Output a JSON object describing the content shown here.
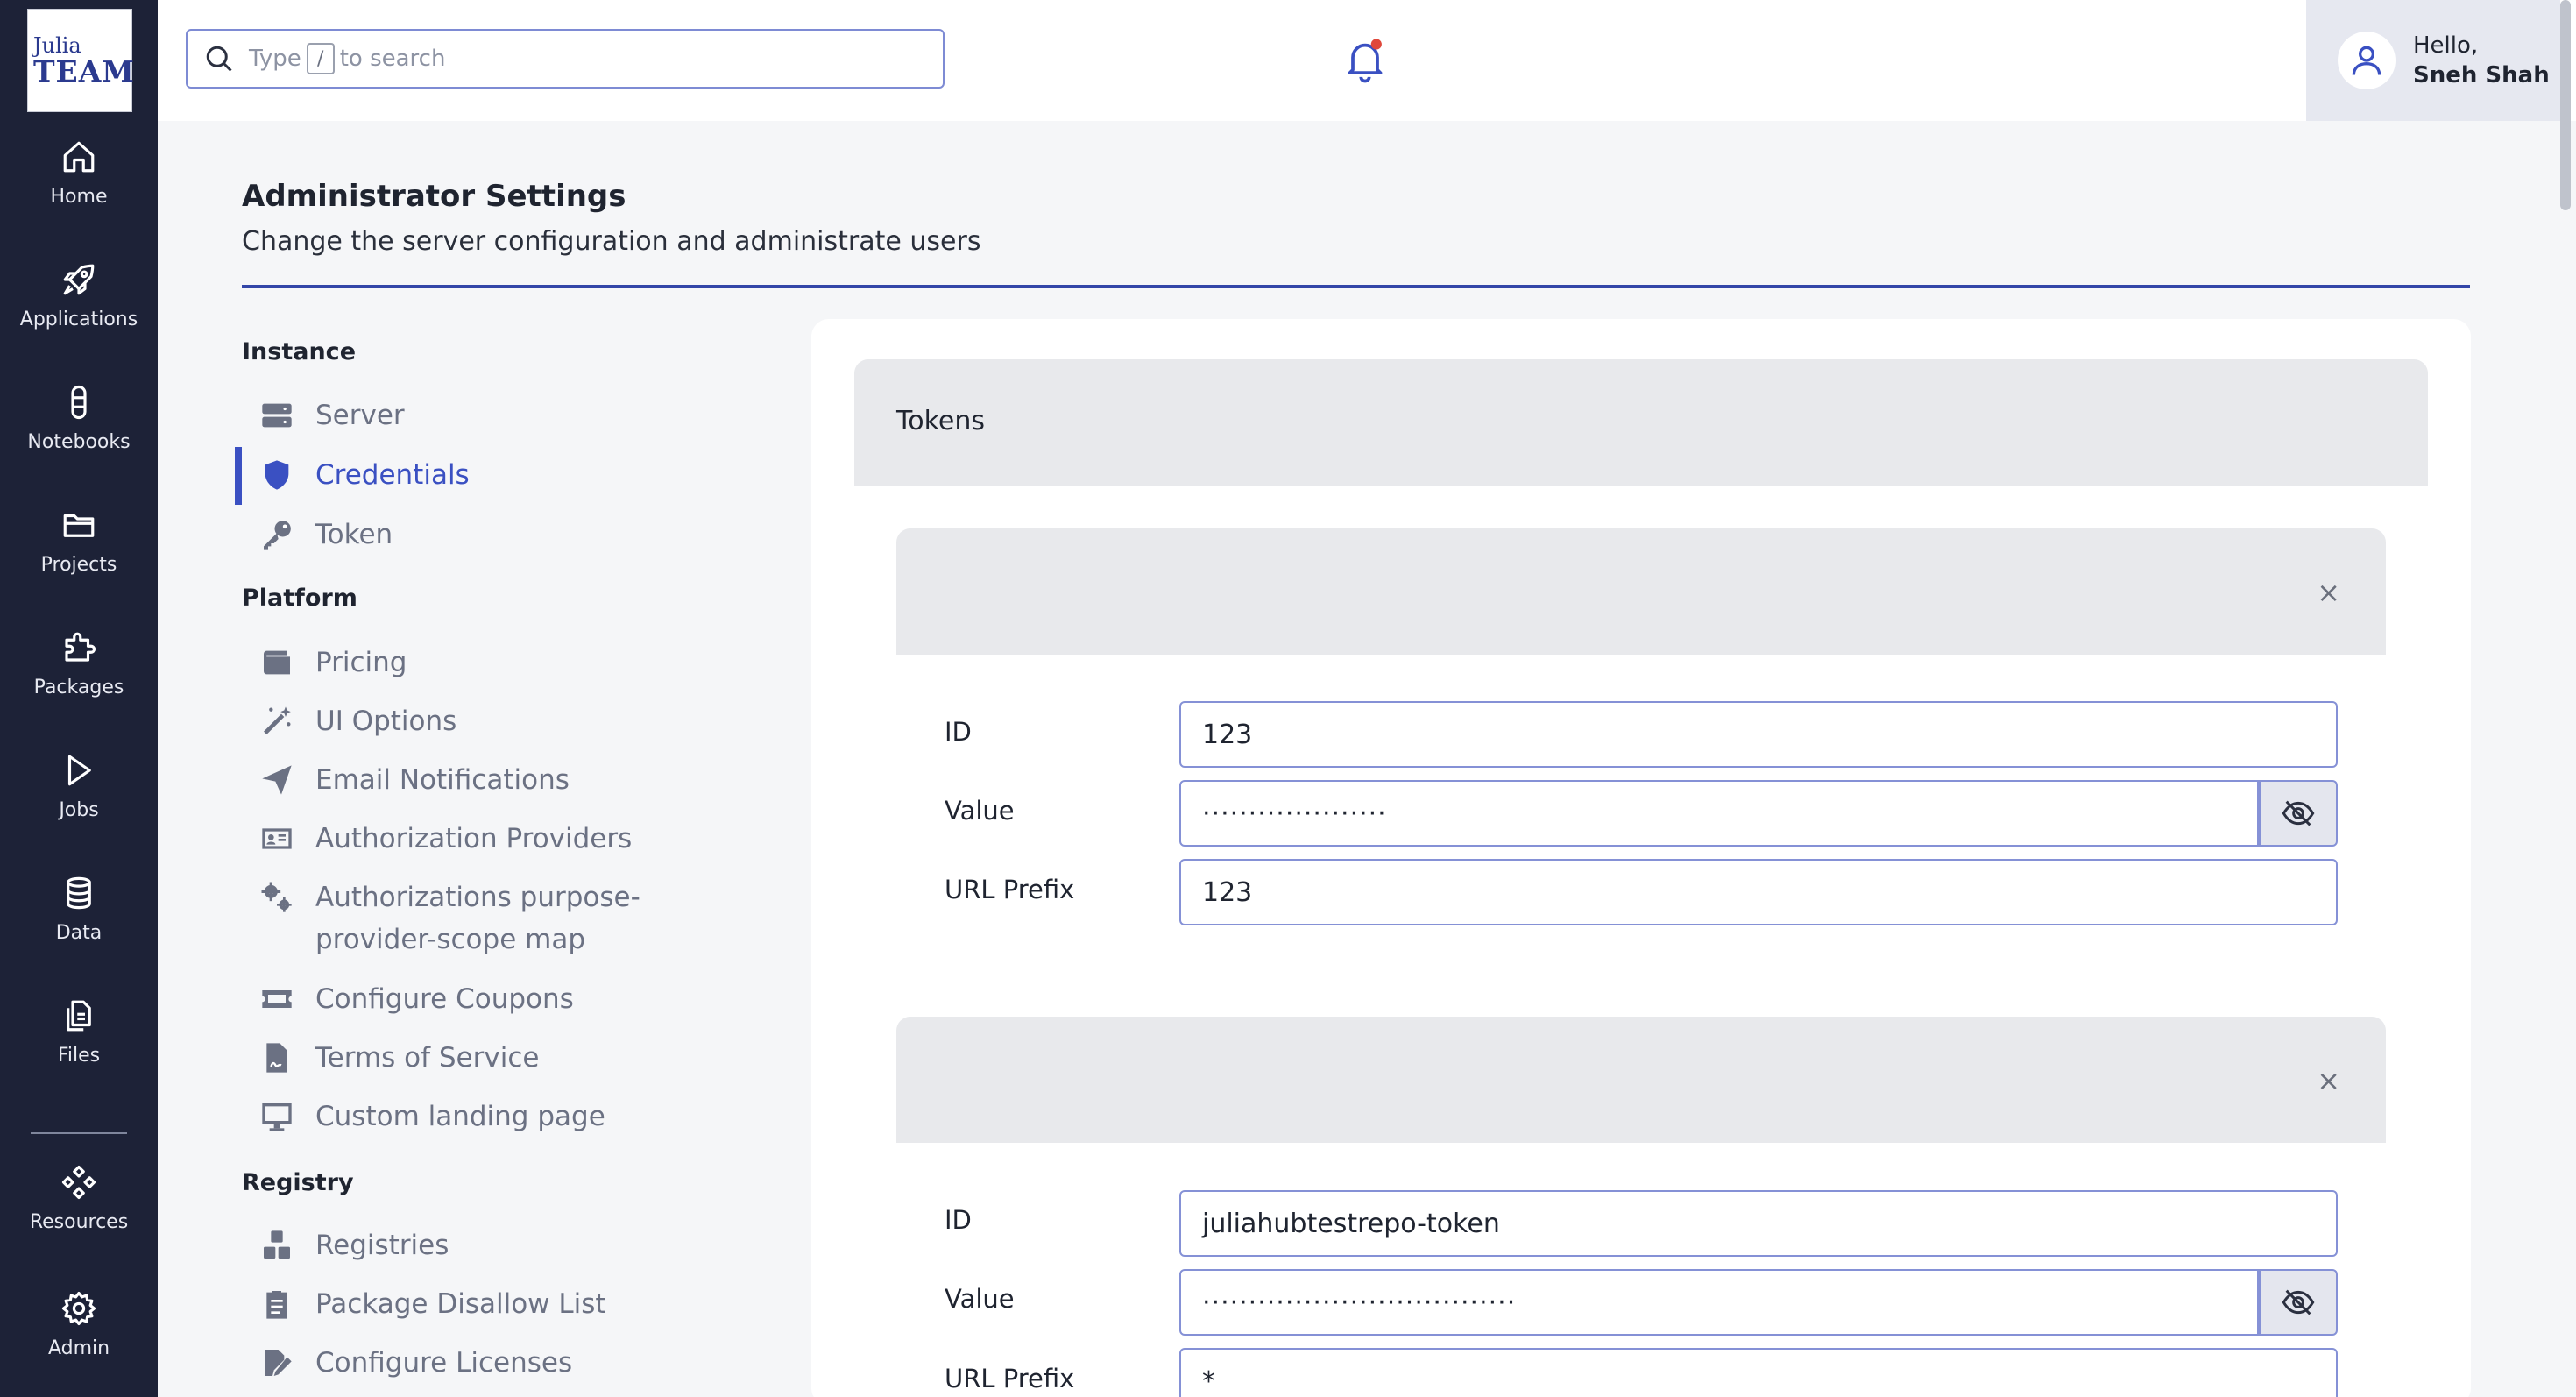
{
  "brand": {
    "logo_line1": "Julia",
    "logo_line2": "TEAM"
  },
  "nav": [
    {
      "label": "Home",
      "icon": "home-icon"
    },
    {
      "label": "Applications",
      "icon": "rocket-icon"
    },
    {
      "label": "Notebooks",
      "icon": "notebook-icon"
    },
    {
      "label": "Projects",
      "icon": "folder-icon"
    },
    {
      "label": "Packages",
      "icon": "puzzle-icon"
    },
    {
      "label": "Jobs",
      "icon": "play-icon"
    },
    {
      "label": "Data",
      "icon": "database-icon"
    },
    {
      "label": "Files",
      "icon": "files-icon"
    },
    {
      "label": "Resources",
      "icon": "resources-icon"
    },
    {
      "label": "Admin",
      "icon": "gear-icon"
    }
  ],
  "search": {
    "prefix": "Type",
    "key": "/",
    "suffix": "to search"
  },
  "user": {
    "greeting": "Hello,",
    "name": "Sneh Shah"
  },
  "page": {
    "title": "Administrator Settings",
    "subtitle": "Change the server configuration and administrate users"
  },
  "settings_nav": {
    "instance": {
      "title": "Instance",
      "items": [
        {
          "label": "Server",
          "icon": "server-icon"
        },
        {
          "label": "Credentials",
          "icon": "shield-icon",
          "active": true
        },
        {
          "label": "Token",
          "icon": "key-icon"
        }
      ]
    },
    "platform": {
      "title": "Platform",
      "items": [
        {
          "label": "Pricing",
          "icon": "wallet-icon"
        },
        {
          "label": "UI Options",
          "icon": "magic-wand-icon"
        },
        {
          "label": "Email Notifications",
          "icon": "paper-plane-icon"
        },
        {
          "label": "Authorization Providers",
          "icon": "id-card-icon"
        },
        {
          "label": "Authorizations purpose-provider-scope map",
          "icon": "gears-icon"
        },
        {
          "label": "Configure Coupons",
          "icon": "ticket-icon"
        },
        {
          "label": "Terms of Service",
          "icon": "contract-icon"
        },
        {
          "label": "Custom landing page",
          "icon": "monitor-icon"
        }
      ]
    },
    "registry": {
      "title": "Registry",
      "items": [
        {
          "label": "Registries",
          "icon": "cubes-icon"
        },
        {
          "label": "Package Disallow List",
          "icon": "clipboard-list-icon"
        },
        {
          "label": "Configure Licenses",
          "icon": "signature-icon"
        }
      ]
    }
  },
  "tokens": {
    "title": "Tokens",
    "close_glyph": "×",
    "field_labels": {
      "id": "ID",
      "value": "Value",
      "url_prefix": "URL Prefix"
    },
    "entries": [
      {
        "id": "123",
        "value_masked": "····················",
        "url_prefix": "123"
      },
      {
        "id": "juliahubtestrepo-token",
        "value_masked": "··································",
        "url_prefix": "*"
      }
    ]
  },
  "colors": {
    "rail": "#1d2237",
    "accent": "#3a50c2",
    "notification_dot": "#e0483b"
  }
}
